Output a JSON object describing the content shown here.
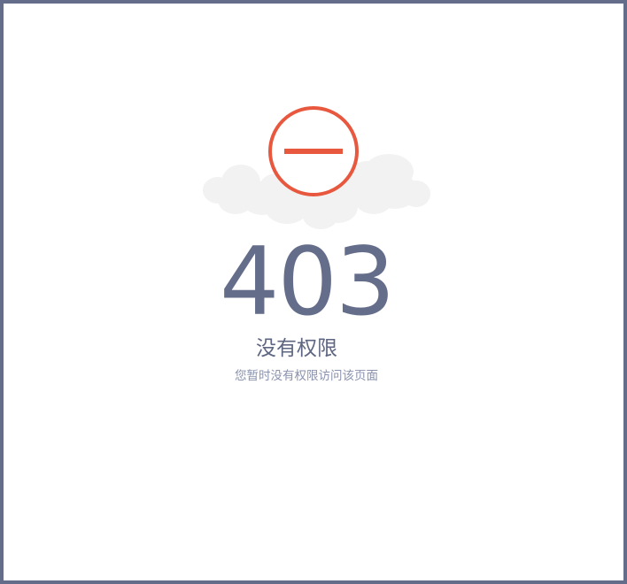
{
  "error": {
    "code": "403",
    "title": "没有权限",
    "description": "您暂时没有权限访问该页面"
  },
  "icons": {
    "main": "no-entry-icon",
    "background": "cloud-icon"
  },
  "colors": {
    "frame_border": "#646d8a",
    "icon_red": "#e8583e",
    "code_text": "#646d8a",
    "title_text": "#5e6682",
    "description_text": "#8a92ad",
    "cloud": "#f2f2f2"
  }
}
